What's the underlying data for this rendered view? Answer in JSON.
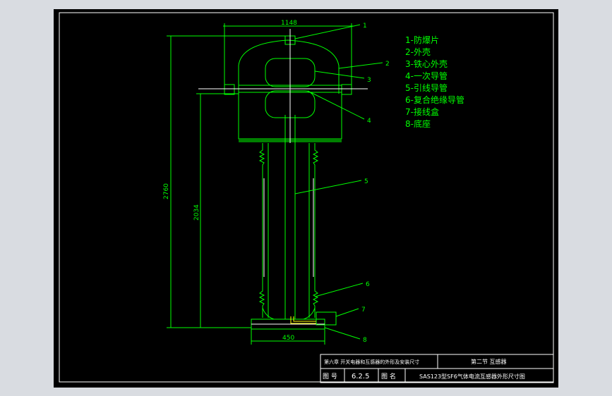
{
  "dimensions": {
    "top_width": "1148",
    "total_height": "2760",
    "body_height": "2034",
    "base_width": "450"
  },
  "leaders": [
    "1",
    "2",
    "3",
    "4",
    "5",
    "6",
    "7",
    "8"
  ],
  "legend": [
    "1-防爆片",
    "2-外壳",
    "3-铁心外壳",
    "4-一次导管",
    "5-引线导管",
    "6-复合绝缘导管",
    "7-接线盒",
    "8-底座"
  ],
  "title_block": {
    "chapter": "第六章  开关电器和互感器的外形及安装尺寸",
    "section": "第二节  互感器",
    "figure_no_label": "图  号",
    "figure_no": "6.2.5",
    "figure_name_label": "图  名",
    "figure_name": "SAS123型SF6气体电流互感器外形尺寸图"
  },
  "colors": {
    "background": "#000000",
    "frame": "#ffffff",
    "drawing": "#00ff00",
    "detail": "#ffff00"
  }
}
